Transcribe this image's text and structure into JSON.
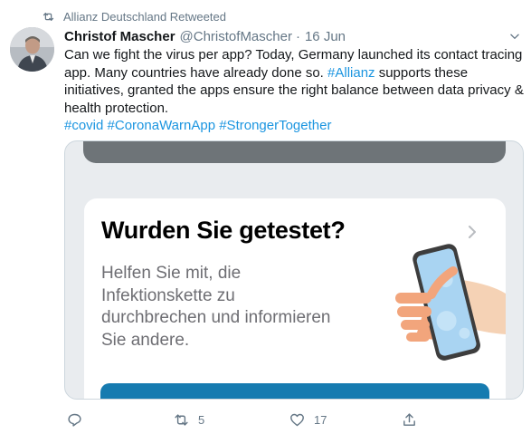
{
  "retweet": {
    "icon": "retweet-icon",
    "text": "Allianz Deutschland Retweeted"
  },
  "tweet": {
    "avatar_icon": "avatar-icon",
    "author_name": "Christof Mascher",
    "author_handle": "@ChristofMascher",
    "separator": "·",
    "date": "16 Jun",
    "body_part1": "Can we fight the virus per app? Today, Germany launched its contact tracing app. Many countries have already done so. ",
    "body_hashtag": "#Allianz",
    "body_part2": " supports these initiatives, granted the apps ensure the right balance between data privacy & health protection.",
    "hashtags": [
      "#covid",
      "#CoronaWarnApp",
      "#StrongerTogether"
    ]
  },
  "media": {
    "card_title": "Wurden Sie getestet?",
    "card_lines": [
      "Helfen Sie mit, die",
      "Infektionskette zu",
      "durchbrechen und informieren",
      "Sie andere."
    ],
    "colors": {
      "button": "#167bb0",
      "phone_screen": "#a9d4f2",
      "hand": "#f2a57c",
      "sleeve": "#f5d2b5"
    }
  },
  "actions": {
    "reply_icon": "reply-icon",
    "retweet_icon": "retweet-icon",
    "retweet_count": "5",
    "like_icon": "heart-icon",
    "like_count": "17",
    "share_icon": "share-icon"
  }
}
